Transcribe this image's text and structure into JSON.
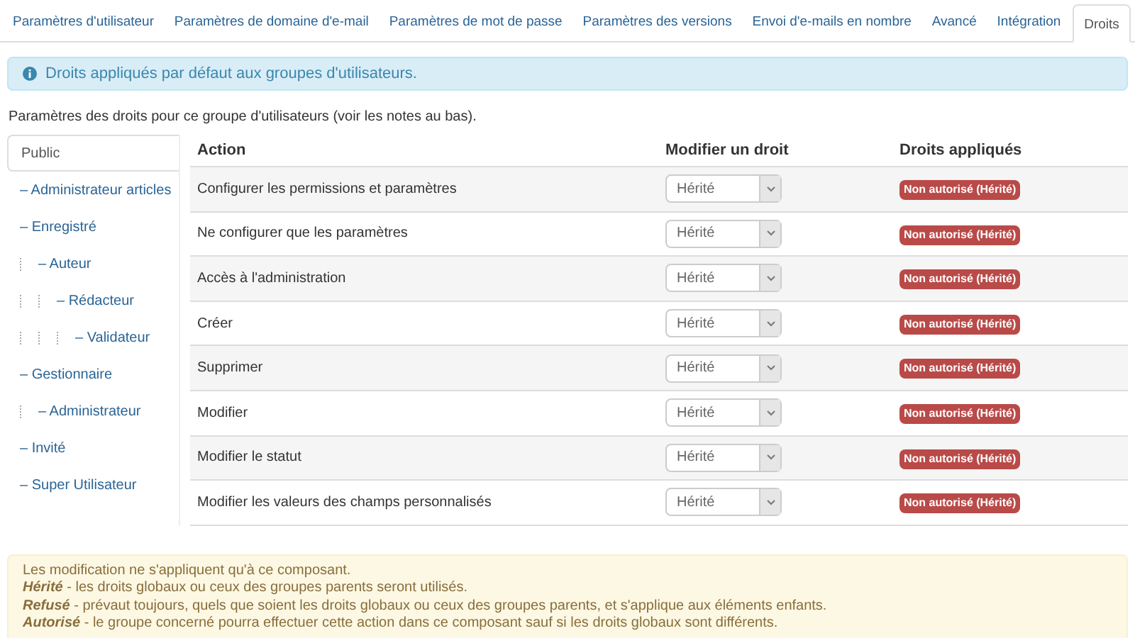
{
  "tabs": [
    {
      "label": "Paramètres d'utilisateur",
      "selected": false
    },
    {
      "label": "Paramètres de domaine d'e-mail",
      "selected": false
    },
    {
      "label": "Paramètres de mot de passe",
      "selected": false
    },
    {
      "label": "Paramètres des versions",
      "selected": false
    },
    {
      "label": "Envoi d'e-mails en nombre",
      "selected": false
    },
    {
      "label": "Avancé",
      "selected": false
    },
    {
      "label": "Intégration",
      "selected": false
    },
    {
      "label": "Droits",
      "selected": true
    }
  ],
  "info_alert": "Droits appliqués par défaut aux groupes d'utilisateurs.",
  "intro": "Paramètres des droits pour ce groupe d'utilisateurs (voir les notes au bas).",
  "groups": [
    {
      "label": "Public",
      "selected": true,
      "children": [
        {
          "label": "– Administrateur articles",
          "selected": false
        },
        {
          "label": "– Enregistré",
          "selected": false,
          "children": [
            {
              "label": "– Auteur",
              "selected": false,
              "children": [
                {
                  "label": "– Rédacteur",
                  "selected": false,
                  "children": [
                    {
                      "label": "– Validateur",
                      "selected": false
                    }
                  ]
                }
              ]
            }
          ]
        },
        {
          "label": "– Gestionnaire",
          "selected": false,
          "children": [
            {
              "label": "– Administrateur",
              "selected": false
            }
          ]
        },
        {
          "label": "– Invité",
          "selected": false
        },
        {
          "label": "– Super Utilisateur",
          "selected": false
        }
      ]
    }
  ],
  "table": {
    "columns": [
      "Action",
      "Modifier un droit",
      "Droits appliqués"
    ],
    "rows": [
      {
        "action": "Configurer les permissions et paramètres",
        "setting": "Hérité",
        "applied": "Non autorisé (Hérité)"
      },
      {
        "action": "Ne configurer que les paramètres",
        "setting": "Hérité",
        "applied": "Non autorisé (Hérité)"
      },
      {
        "action": "Accès à l'administration",
        "setting": "Hérité",
        "applied": "Non autorisé (Hérité)"
      },
      {
        "action": "Créer",
        "setting": "Hérité",
        "applied": "Non autorisé (Hérité)"
      },
      {
        "action": "Supprimer",
        "setting": "Hérité",
        "applied": "Non autorisé (Hérité)"
      },
      {
        "action": "Modifier",
        "setting": "Hérité",
        "applied": "Non autorisé (Hérité)"
      },
      {
        "action": "Modifier le statut",
        "setting": "Hérité",
        "applied": "Non autorisé (Hérité)"
      },
      {
        "action": "Modifier les valeurs des champs personnalisés",
        "setting": "Hérité",
        "applied": "Non autorisé (Hérité)"
      }
    ]
  },
  "notes": [
    "Les modification ne s'appliquent qu'à ce composant.",
    "**Hérité** - les droits globaux ou ceux des groupes parents seront utilisés.",
    "**Refusé** - prévaut toujours, quels que soient les droits globaux ou ceux des groupes parents, et s'applique aux éléments enfants.",
    "**Autorisé** - le groupe concerné pourra effectuer cette action dans ce composant sauf si les droits globaux sont différents."
  ]
}
